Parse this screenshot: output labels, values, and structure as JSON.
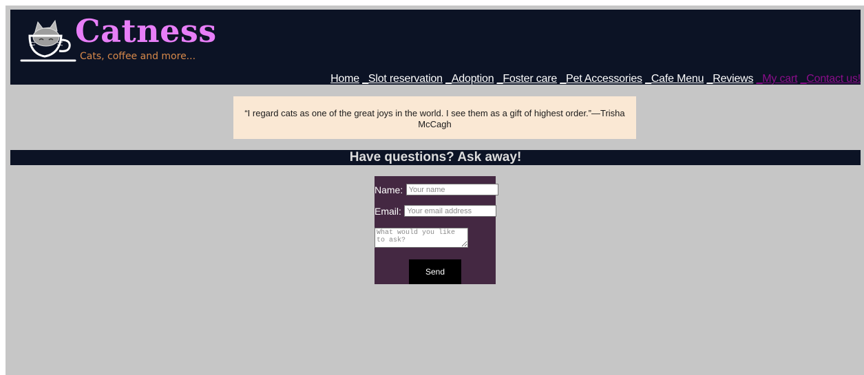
{
  "brand": {
    "name": "Catness",
    "tagline": "Cats, coffee and more...",
    "title_color": "#e77ef7",
    "tagline_color": "#d8894a"
  },
  "nav": {
    "items": [
      {
        "label": "Home",
        "visited": false
      },
      {
        "label": "Slot reservation",
        "visited": false
      },
      {
        "label": "Adoption",
        "visited": false
      },
      {
        "label": "Foster care",
        "visited": false
      },
      {
        "label": "Pet Accessories",
        "visited": false
      },
      {
        "label": "Cafe Menu",
        "visited": false
      },
      {
        "label": "Reviews",
        "visited": false
      },
      {
        "label": "My cart",
        "visited": true
      },
      {
        "label": "Contact us!",
        "visited": true
      }
    ],
    "separator": "_"
  },
  "quote": {
    "text": "“I regard cats as one of the great joys in the world. I see them as a gift of highest order.”―Trisha McCagh"
  },
  "questions": {
    "title": "Have questions? Ask away!"
  },
  "form": {
    "name_label": "Name:",
    "name_placeholder": "Your name",
    "email_label": "Email:",
    "email_placeholder": "Your email address",
    "question_placeholder": "What would you like to ask?",
    "send_label": "Send"
  },
  "colors": {
    "page_background": "#c6c6c6",
    "header_background": "#0c1325",
    "quote_background": "#fae8d4",
    "form_background": "#442842",
    "visited_link": "#8b0d8b"
  },
  "icons": {
    "logo": "cat-in-coffee-cup-icon"
  }
}
